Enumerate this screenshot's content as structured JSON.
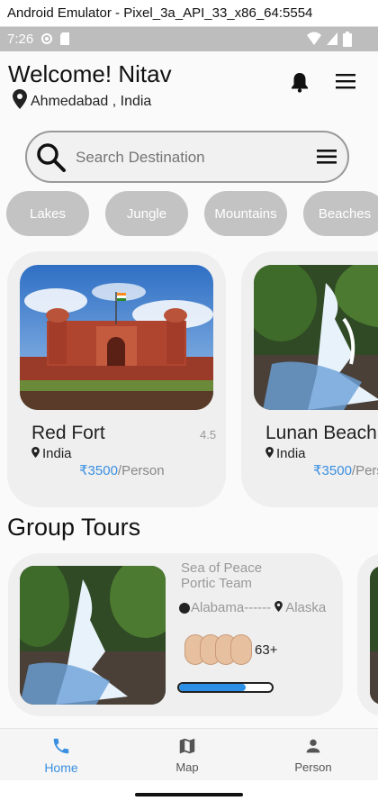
{
  "window": {
    "title": "Android Emulator - Pixel_3a_API_33_x86_64:5554"
  },
  "status_bar": {
    "time": "7:26"
  },
  "header": {
    "welcome": "Welcome! Nitav",
    "location": "Ahmedabad , India"
  },
  "search": {
    "placeholder": "Search Destination"
  },
  "categories": [
    "Lakes",
    "Jungle",
    "Mountains",
    "Beaches"
  ],
  "places": [
    {
      "name": "Red Fort",
      "rating": "4.5",
      "country": "India",
      "price": "₹3500",
      "per": "/Person"
    },
    {
      "name": "Lunan Beach",
      "rating": "",
      "country": "India",
      "price": "₹3500",
      "per": "/Person"
    }
  ],
  "group_tours": {
    "title": "Group Tours",
    "card": {
      "name": "Sea of Peace Portic Team",
      "from": "Alabama------",
      "to": "Alaska",
      "count": "63+",
      "progress": 0.72
    }
  },
  "bottom_nav": [
    {
      "label": "Home",
      "active": true
    },
    {
      "label": "Map",
      "active": false
    },
    {
      "label": "Person",
      "active": false
    }
  ],
  "colors": {
    "accent": "#3a8fe0",
    "chip": "#c3c3c3",
    "card": "#efefef",
    "progress": "#2b8fe6"
  }
}
